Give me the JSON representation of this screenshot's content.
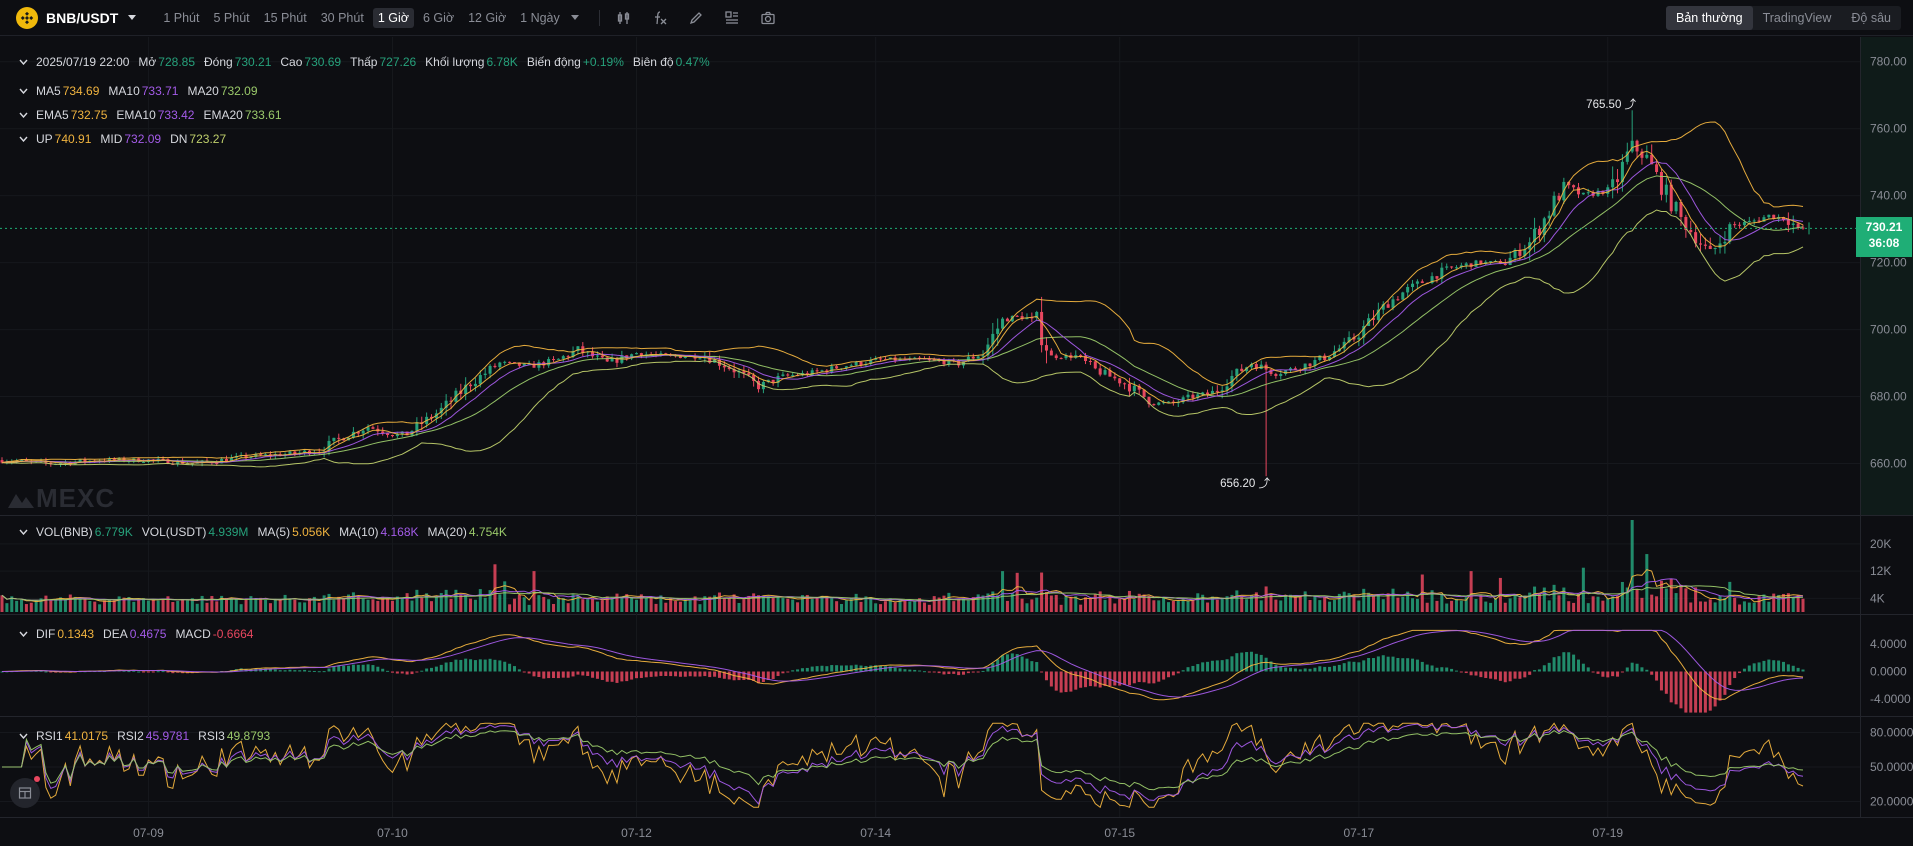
{
  "colors": {
    "up": "#26a17b",
    "down": "#e8475f",
    "ma5": "#f0b33f",
    "ma10": "#a35be8",
    "ma20": "#9ac96a",
    "boll_up": "#f0b33f",
    "boll_mid": "#a35be8",
    "boll_dn": "#bfcf6b",
    "grid": "#16181d",
    "axis_text": "#8a8d96"
  },
  "header": {
    "pair": "BNB/USDT",
    "intervals": [
      "1 Phút",
      "5 Phút",
      "15 Phút",
      "30 Phút",
      "1 Giờ",
      "6 Giờ",
      "12 Giờ",
      "1 Ngày"
    ],
    "active_interval": "1 Giờ",
    "tools": [
      "candle-type-icon",
      "indicator-fx-icon",
      "draw-pencil-icon",
      "layout-grid-icon",
      "camera-icon"
    ],
    "views": [
      "Bản thường",
      "TradingView",
      "Độ sâu"
    ],
    "active_view": "Bản thường"
  },
  "ohlc": {
    "date": "2025/07/19 22:00",
    "open_label": "Mở",
    "open": "728.85",
    "close_label": "Đóng",
    "close": "730.21",
    "high_label": "Cao",
    "high": "730.69",
    "low_label": "Thấp",
    "low": "727.26",
    "volume_label": "Khối lượng",
    "volume": "6.78K",
    "change_label": "Biến động",
    "change": "+0.19%",
    "amplitude_label": "Biên độ",
    "amplitude": "0.47%"
  },
  "legends": {
    "ma": [
      {
        "label": "MA5",
        "value": "734.69"
      },
      {
        "label": "MA10",
        "value": "733.71"
      },
      {
        "label": "MA20",
        "value": "732.09"
      }
    ],
    "ema": [
      {
        "label": "EMA5",
        "value": "732.75"
      },
      {
        "label": "EMA10",
        "value": "733.42"
      },
      {
        "label": "EMA20",
        "value": "733.61"
      }
    ],
    "boll": [
      {
        "label": "UP",
        "value": "740.91"
      },
      {
        "label": "MID",
        "value": "732.09"
      },
      {
        "label": "DN",
        "value": "723.27"
      }
    ],
    "vol": [
      {
        "label": "VOL(BNB)",
        "value": "6.779K"
      },
      {
        "label": "VOL(USDT)",
        "value": "4.939M"
      },
      {
        "label": "MA(5)",
        "value": "5.056K"
      },
      {
        "label": "MA(10)",
        "value": "4.168K"
      },
      {
        "label": "MA(20)",
        "value": "4.754K"
      }
    ],
    "macd": [
      {
        "label": "DIF",
        "value": "0.1343"
      },
      {
        "label": "DEA",
        "value": "0.4675"
      },
      {
        "label": "MACD",
        "value": "-0.6664"
      }
    ],
    "rsi": [
      {
        "label": "RSI1",
        "value": "41.0175"
      },
      {
        "label": "RSI2",
        "value": "45.9781"
      },
      {
        "label": "RSI3",
        "value": "49.8793"
      }
    ]
  },
  "current": {
    "price": "730.21",
    "countdown": "36:08"
  },
  "extremes": {
    "high": "765.50",
    "low": "656.20"
  },
  "watermark": "MEXC",
  "chart_data": [
    {
      "type": "candlestick",
      "name": "BNB/USDT 1h price",
      "x_labels": [
        "07-09",
        "07-10",
        "07-12",
        "07-14",
        "07-15",
        "07-17",
        "07-19"
      ],
      "y_ticks": [
        660,
        680,
        700,
        720,
        740,
        760,
        780
      ],
      "y_tick_labels": [
        "660.00",
        "680.00",
        "700.00",
        "720.00",
        "740.00",
        "760.00",
        "780.00"
      ],
      "ylim": [
        647,
        785
      ],
      "anchors": [
        [
          0,
          661
        ],
        [
          10,
          660
        ],
        [
          20,
          661
        ],
        [
          30,
          661
        ],
        [
          40,
          660
        ],
        [
          50,
          662
        ],
        [
          60,
          663
        ],
        [
          65,
          664
        ],
        [
          70,
          668
        ],
        [
          75,
          671
        ],
        [
          82,
          668
        ],
        [
          90,
          676
        ],
        [
          96,
          684
        ],
        [
          102,
          690
        ],
        [
          108,
          689
        ],
        [
          114,
          691
        ],
        [
          118,
          694
        ],
        [
          124,
          690
        ],
        [
          130,
          693
        ],
        [
          136,
          692
        ],
        [
          144,
          692
        ],
        [
          150,
          688
        ],
        [
          155,
          683
        ],
        [
          160,
          686
        ],
        [
          166,
          687
        ],
        [
          172,
          689
        ],
        [
          180,
          691
        ],
        [
          188,
          691
        ],
        [
          196,
          690
        ],
        [
          201,
          693
        ],
        [
          205,
          703
        ],
        [
          209,
          704
        ],
        [
          212,
          702
        ],
        [
          215,
          692
        ],
        [
          220,
          692
        ],
        [
          224,
          688
        ],
        [
          230,
          684
        ],
        [
          236,
          678
        ],
        [
          240,
          678
        ],
        [
          244,
          680
        ],
        [
          248,
          681
        ],
        [
          252,
          686
        ],
        [
          256,
          690
        ],
        [
          261,
          687
        ],
        [
          264,
          688
        ],
        [
          270,
          691
        ],
        [
          276,
          696
        ],
        [
          280,
          702
        ],
        [
          284,
          708
        ],
        [
          288,
          712
        ],
        [
          292,
          715
        ],
        [
          296,
          718
        ],
        [
          302,
          720
        ],
        [
          308,
          720
        ],
        [
          313,
          726
        ],
        [
          316,
          733
        ],
        [
          320,
          743
        ],
        [
          324,
          740
        ],
        [
          330,
          742
        ],
        [
          334,
          755
        ],
        [
          337,
          751
        ],
        [
          340,
          743
        ],
        [
          344,
          733
        ],
        [
          348,
          726
        ],
        [
          350,
          722
        ],
        [
          354,
          731
        ],
        [
          358,
          732
        ],
        [
          362,
          734
        ],
        [
          366,
          733
        ],
        [
          368,
          730
        ]
      ],
      "extreme_high": {
        "index": 334,
        "value": 765.5
      },
      "extreme_low": {
        "index": 259,
        "value": 656.2
      },
      "current_price": 730.21,
      "overlays": [
        "MA5",
        "MA10",
        "MA20",
        "BOLL(20)"
      ]
    },
    {
      "type": "bar",
      "name": "Volume",
      "y_ticks": [
        4000,
        12000,
        20000
      ],
      "y_tick_labels": [
        "4K",
        "12K",
        "20K"
      ],
      "ylim": [
        0,
        27000
      ],
      "spikes": [
        [
          101,
          14000
        ],
        [
          103,
          9000
        ],
        [
          109,
          12000
        ],
        [
          205,
          12000
        ],
        [
          208,
          11500
        ],
        [
          259,
          7500
        ],
        [
          291,
          11000
        ],
        [
          301,
          12000
        ],
        [
          307,
          10000
        ],
        [
          324,
          13000
        ],
        [
          334,
          27000
        ],
        [
          337,
          17000
        ]
      ]
    },
    {
      "type": "line",
      "name": "MACD",
      "y_ticks": [
        -4,
        0,
        4
      ],
      "y_tick_labels": [
        "-4.0000",
        "0.0000",
        "4.0000"
      ],
      "ylim": [
        -6.5,
        6.5
      ]
    },
    {
      "type": "line",
      "name": "RSI",
      "y_ticks": [
        20,
        50,
        80
      ],
      "y_tick_labels": [
        "20.0000",
        "50.0000",
        "80.0000"
      ],
      "ylim": [
        10,
        90
      ]
    }
  ]
}
